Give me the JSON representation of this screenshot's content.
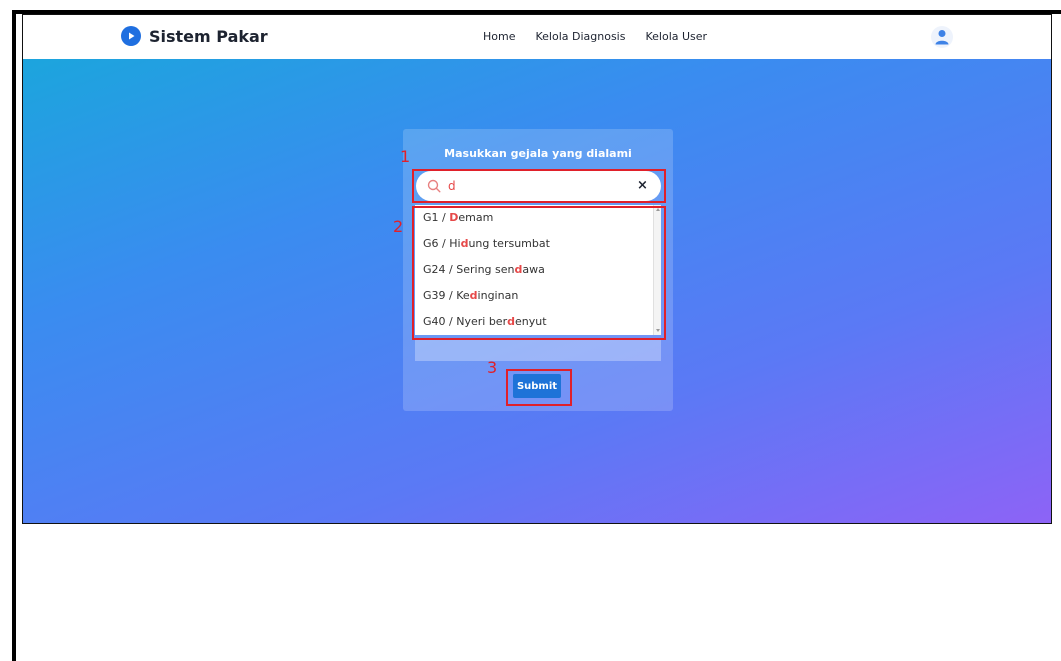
{
  "navbar": {
    "brand": "Sistem Pakar",
    "links": [
      "Home",
      "Kelola Diagnosis",
      "Kelola User"
    ]
  },
  "form": {
    "title": "Masukkan gejala yang dialami",
    "search_value": "d",
    "clear_label": "×",
    "results": [
      {
        "code": "G1",
        "parts": [
          "",
          "D",
          "emam"
        ]
      },
      {
        "code": "G6",
        "parts": [
          "Hi",
          "d",
          "ung tersumbat"
        ]
      },
      {
        "code": "G24",
        "parts": [
          "Sering sen",
          "d",
          "awa"
        ]
      },
      {
        "code": "G39",
        "parts": [
          "Ke",
          "d",
          "inginan"
        ]
      },
      {
        "code": "G40",
        "parts": [
          "Nyeri ber",
          "d",
          "enyut"
        ]
      }
    ],
    "submit_label": "Submit"
  },
  "annotations": [
    "1",
    "2",
    "3"
  ],
  "colors": {
    "accent": "#1e73d8",
    "highlight": "#e64848",
    "annotation": "#e0202a"
  }
}
